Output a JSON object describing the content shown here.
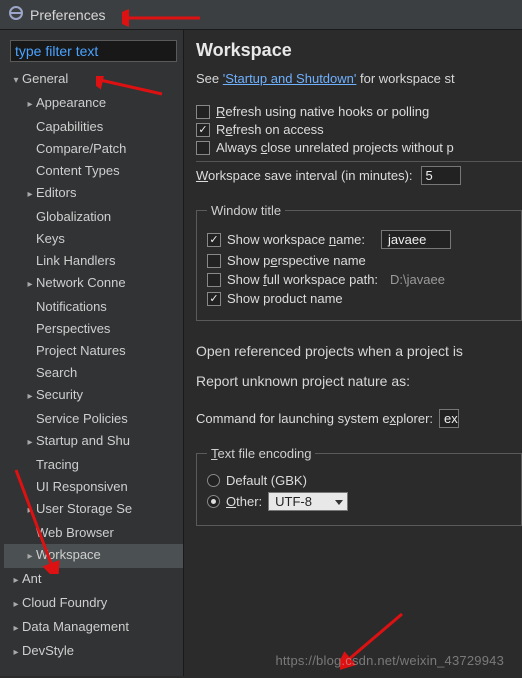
{
  "window": {
    "title": "Preferences"
  },
  "filter": {
    "placeholder": "type filter text",
    "value": "type filter text"
  },
  "tree": {
    "items": [
      {
        "label": "General",
        "depth": 0,
        "exp": true,
        "hasChildren": true
      },
      {
        "label": "Appearance",
        "depth": 1,
        "exp": false,
        "hasChildren": true
      },
      {
        "label": "Capabilities",
        "depth": 1,
        "hasChildren": false
      },
      {
        "label": "Compare/Patch",
        "depth": 1,
        "hasChildren": false
      },
      {
        "label": "Content Types",
        "depth": 1,
        "hasChildren": false
      },
      {
        "label": "Editors",
        "depth": 1,
        "exp": false,
        "hasChildren": true
      },
      {
        "label": "Globalization",
        "depth": 1,
        "hasChildren": false
      },
      {
        "label": "Keys",
        "depth": 1,
        "hasChildren": false
      },
      {
        "label": "Link Handlers",
        "depth": 1,
        "hasChildren": false
      },
      {
        "label": "Network Conne",
        "depth": 1,
        "exp": false,
        "hasChildren": true
      },
      {
        "label": "Notifications",
        "depth": 1,
        "hasChildren": false
      },
      {
        "label": "Perspectives",
        "depth": 1,
        "hasChildren": false
      },
      {
        "label": "Project Natures",
        "depth": 1,
        "hasChildren": false
      },
      {
        "label": "Search",
        "depth": 1,
        "hasChildren": false
      },
      {
        "label": "Security",
        "depth": 1,
        "exp": false,
        "hasChildren": true
      },
      {
        "label": "Service Policies",
        "depth": 1,
        "hasChildren": false
      },
      {
        "label": "Startup and Shu",
        "depth": 1,
        "exp": false,
        "hasChildren": true
      },
      {
        "label": "Tracing",
        "depth": 1,
        "hasChildren": false
      },
      {
        "label": "UI Responsiven",
        "depth": 1,
        "hasChildren": false
      },
      {
        "label": "User Storage Se",
        "depth": 1,
        "exp": false,
        "hasChildren": true
      },
      {
        "label": "Web Browser",
        "depth": 1,
        "hasChildren": false
      },
      {
        "label": "Workspace",
        "depth": 1,
        "exp": false,
        "hasChildren": true,
        "selected": true
      },
      {
        "label": "Ant",
        "depth": 0,
        "exp": false,
        "hasChildren": true
      },
      {
        "label": "Cloud Foundry",
        "depth": 0,
        "exp": false,
        "hasChildren": true
      },
      {
        "label": "Data Management",
        "depth": 0,
        "exp": false,
        "hasChildren": true
      },
      {
        "label": "DevStyle",
        "depth": 0,
        "exp": false,
        "hasChildren": true
      }
    ]
  },
  "page": {
    "heading": "Workspace",
    "see_prefix": "See ",
    "see_link": "'Startup and Shutdown'",
    "see_suffix": " for workspace st",
    "refresh_hooks": {
      "checked": false,
      "label": "Refresh using native hooks or polling",
      "u": "R"
    },
    "refresh_access": {
      "checked": true,
      "label": "Refresh on access",
      "u": "e"
    },
    "close_unrelated": {
      "checked": false,
      "label": "Always close unrelated projects without p",
      "u": "c"
    },
    "interval_label": "Workspace save interval (in minutes):",
    "interval_u": "W",
    "interval_value": "5",
    "wt_legend": "Window title",
    "wt_name": {
      "checked": true,
      "label": "Show workspace name:",
      "u": "n",
      "value": "javaee"
    },
    "wt_persp": {
      "checked": false,
      "label": "Show perspective name",
      "u": "e"
    },
    "wt_path": {
      "checked": false,
      "label": "Show full workspace path:",
      "u": "f",
      "value": "D:\\javaee"
    },
    "wt_prod": {
      "checked": true,
      "label": "Show product name"
    },
    "open_ref": "Open referenced projects when a project is",
    "report_nature": "Report unknown project nature as:",
    "cmd_label": "Command for launching system explorer:",
    "cmd_u": "x",
    "cmd_value": "ex",
    "enc_legend": "Text file encoding",
    "enc_u": "T",
    "enc_default": {
      "checked": false,
      "label": "Default (GBK)"
    },
    "enc_other": {
      "checked": true,
      "label": "Other:",
      "u": "O",
      "value": "UTF-8"
    }
  },
  "watermark": "https://blog.csdn.net/weixin_43729943"
}
